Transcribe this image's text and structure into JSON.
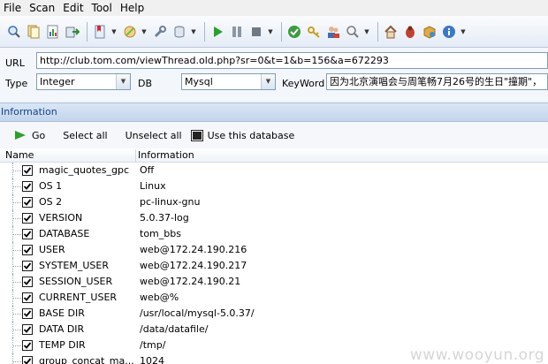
{
  "menu": [
    "File",
    "Scan",
    "Edit",
    "Tool",
    "Help"
  ],
  "fields": {
    "url_label": "URL",
    "url_value": "http://club.tom.com/viewThread.old.php?sr=0&t=1&b=156&a=672293",
    "type_label": "Type",
    "type_value": "Integer",
    "db_label": "DB",
    "db_value": "Mysql",
    "keyword_label": "KeyWord",
    "keyword_value": "因为北京演唱会与周笔畅7月26号的生日\"撞期\"，"
  },
  "section": {
    "title": "Information"
  },
  "actions": {
    "go": "Go",
    "select_all": "Select all",
    "unselect_all": "Unselect all",
    "use_db": "Use this database"
  },
  "table": {
    "headers": [
      "Name",
      "Information"
    ],
    "rows": [
      {
        "name": "magic_quotes_gpc",
        "value": "Off"
      },
      {
        "name": "OS 1",
        "value": "Linux"
      },
      {
        "name": "OS 2",
        "value": "pc-linux-gnu"
      },
      {
        "name": "VERSION",
        "value": "5.0.37-log"
      },
      {
        "name": "DATABASE",
        "value": "tom_bbs"
      },
      {
        "name": "USER",
        "value": "web@172.24.190.216"
      },
      {
        "name": "SYSTEM_USER",
        "value": "web@172.24.190.217"
      },
      {
        "name": "SESSION_USER",
        "value": "web@172.24.190.21"
      },
      {
        "name": "CURRENT_USER",
        "value": "web@%"
      },
      {
        "name": "BASE DIR",
        "value": "/usr/local/mysql-5.0.37/"
      },
      {
        "name": "DATA DIR",
        "value": "/data/datafile/"
      },
      {
        "name": "TEMP DIR",
        "value": "/tmp/"
      },
      {
        "name": "group_concat_ma...",
        "value": "1024"
      }
    ]
  },
  "watermark": "www.wooyun.org",
  "colors": {
    "accent": "#15428b",
    "section_bg": "#c9d9ee",
    "go_green": "#2aa12a"
  }
}
